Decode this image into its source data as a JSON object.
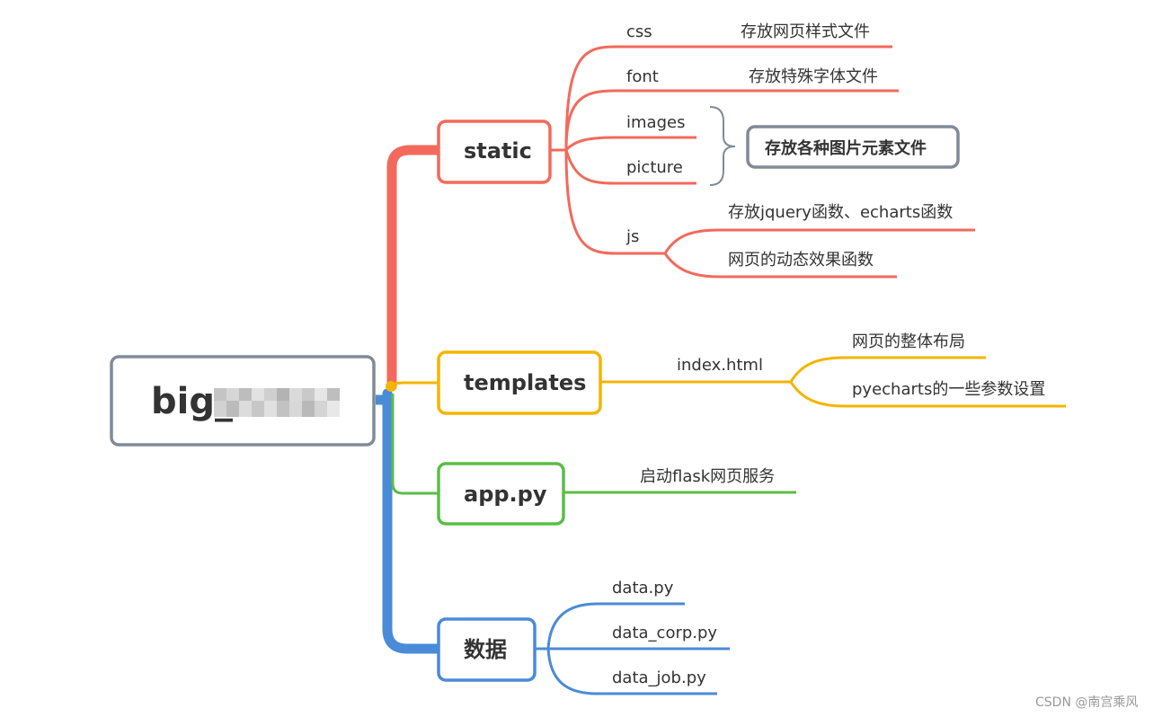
{
  "root": {
    "label": "big_",
    "border_color": "#808a99",
    "blur_colors": [
      "#c4c4c4",
      "#d6d6d6",
      "#bdbdbd",
      "#e2e2e2",
      "#cfcfcf",
      "#b3b3b3",
      "#dadada",
      "#c9c9c9",
      "#e6e6e6",
      "#bebebe",
      "#d2d2d2",
      "#c7c7c7"
    ]
  },
  "branches": {
    "static": {
      "label": "static",
      "color": "#f26a5c",
      "items": {
        "css": {
          "name": "css",
          "desc": "存放网页样式文件"
        },
        "font": {
          "name": "font",
          "desc": "存放特殊字体文件"
        },
        "images": {
          "name": "images"
        },
        "picture": {
          "name": "picture"
        },
        "js": {
          "name": "js",
          "desc1": "存放jquery函数、echarts函数",
          "desc2": "网页的动态效果函数"
        }
      },
      "group_label": "存放各种图片元素文件",
      "group_color": "#808a99"
    },
    "templates": {
      "label": "templates",
      "color": "#f5b400",
      "file": "index.html",
      "desc1": "网页的整体布局",
      "desc2": "pyecharts的一些参数设置"
    },
    "app": {
      "label": "app.py",
      "color": "#5bbd47",
      "desc": "启动flask网页服务"
    },
    "data": {
      "label": "数据",
      "color": "#4a8bd8",
      "files": [
        "data.py",
        "data_corp.py",
        "data_job.py"
      ]
    }
  },
  "watermark": "CSDN @南宫乘风"
}
